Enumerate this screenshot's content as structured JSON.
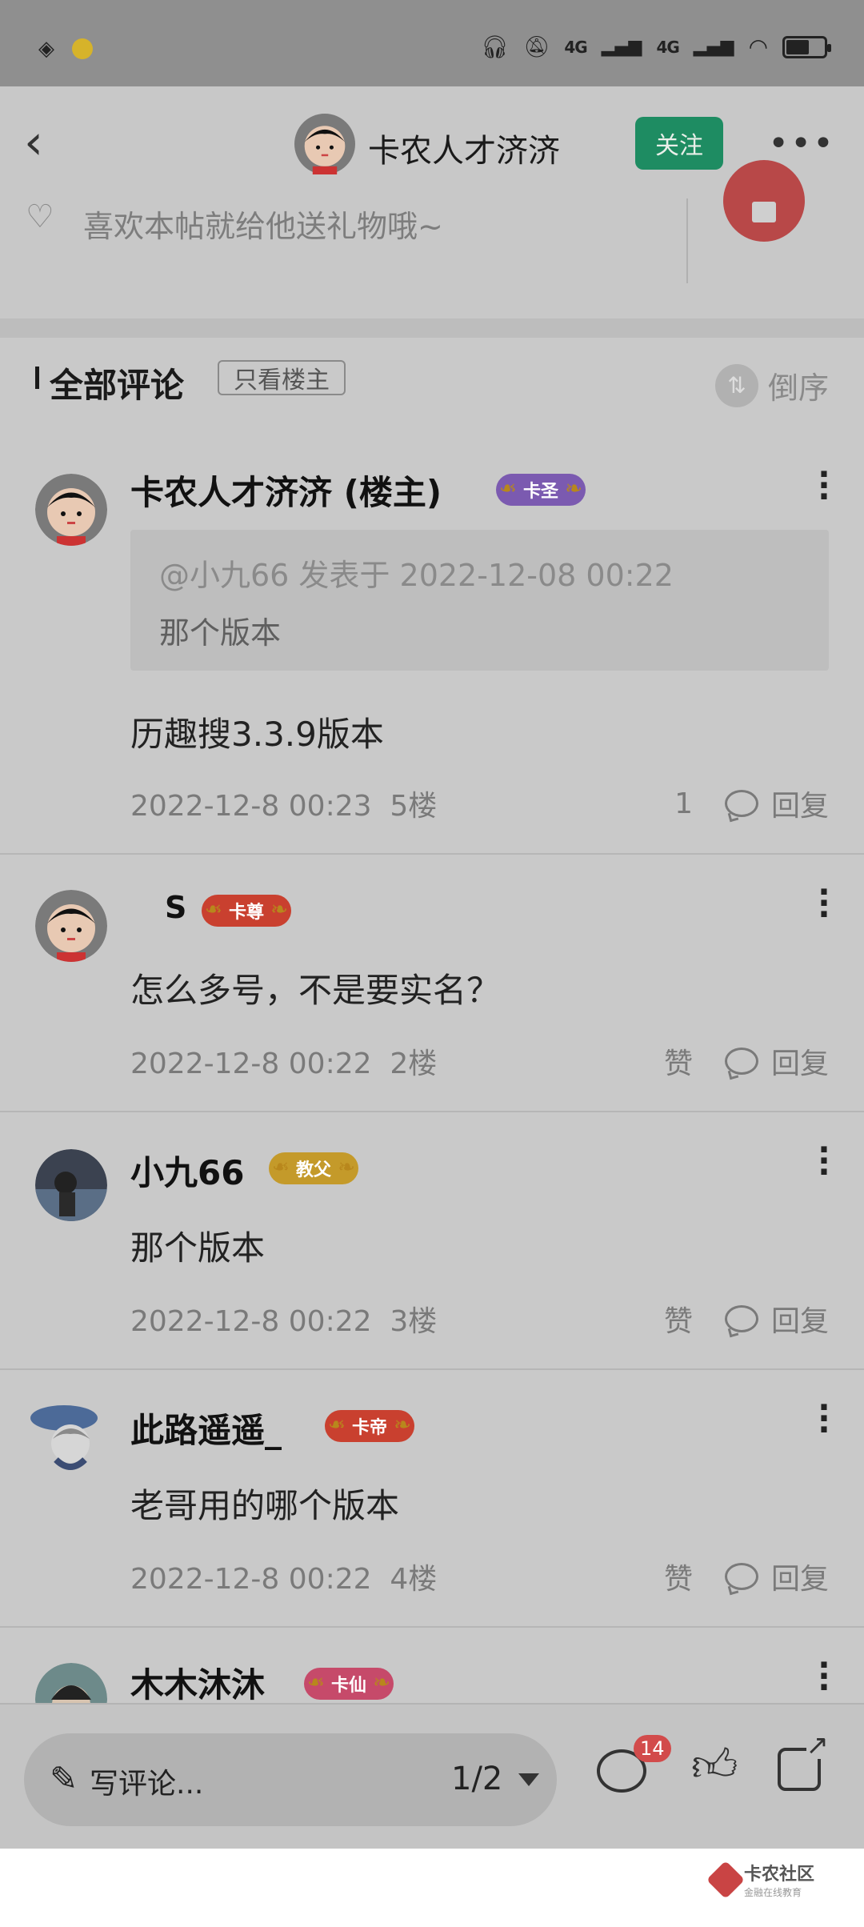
{
  "header": {
    "title": "卡农人才济济",
    "follow_label": "关注"
  },
  "gift": {
    "text": "喜欢本帖就给他送礼物哦~"
  },
  "comments_header": {
    "title": "全部评论",
    "only_owner": "只看楼主",
    "sort_label": "倒序"
  },
  "comments": [
    {
      "name": "卡农人才济济 (楼主)",
      "badge": "卡圣",
      "quote_line1": "@小九66 发表于 2022-12-08 00:22",
      "quote_line2": "那个版本",
      "body": "历趣搜3.3.9版本",
      "time": "2022-12-8 00:23",
      "floor": "5楼",
      "like": "1",
      "reply": "回复"
    },
    {
      "name": "S",
      "badge": "卡尊",
      "body": "怎么多号，不是要实名？",
      "time": "2022-12-8 00:22",
      "floor": "2楼",
      "like": "赞",
      "reply": "回复"
    },
    {
      "name": "小九66",
      "badge": "教父",
      "body": "那个版本",
      "time": "2022-12-8 00:22",
      "floor": "3楼",
      "like": "赞",
      "reply": "回复"
    },
    {
      "name": "此路遥遥_",
      "badge": "卡帝",
      "body": "老哥用的哪个版本",
      "time": "2022-12-8 00:22",
      "floor": "4楼",
      "like": "赞",
      "reply": "回复"
    },
    {
      "name": "木木沐沐",
      "badge": "卡仙"
    }
  ],
  "bottom_bar": {
    "write_placeholder": "写评论...",
    "page": "1/2",
    "comment_count": "14"
  },
  "watermark": {
    "title": "卡农社区",
    "subtitle": "金融在线教育"
  },
  "status_bar": {
    "net1": "4G",
    "net2": "4G",
    "battery_level": 0.6
  }
}
